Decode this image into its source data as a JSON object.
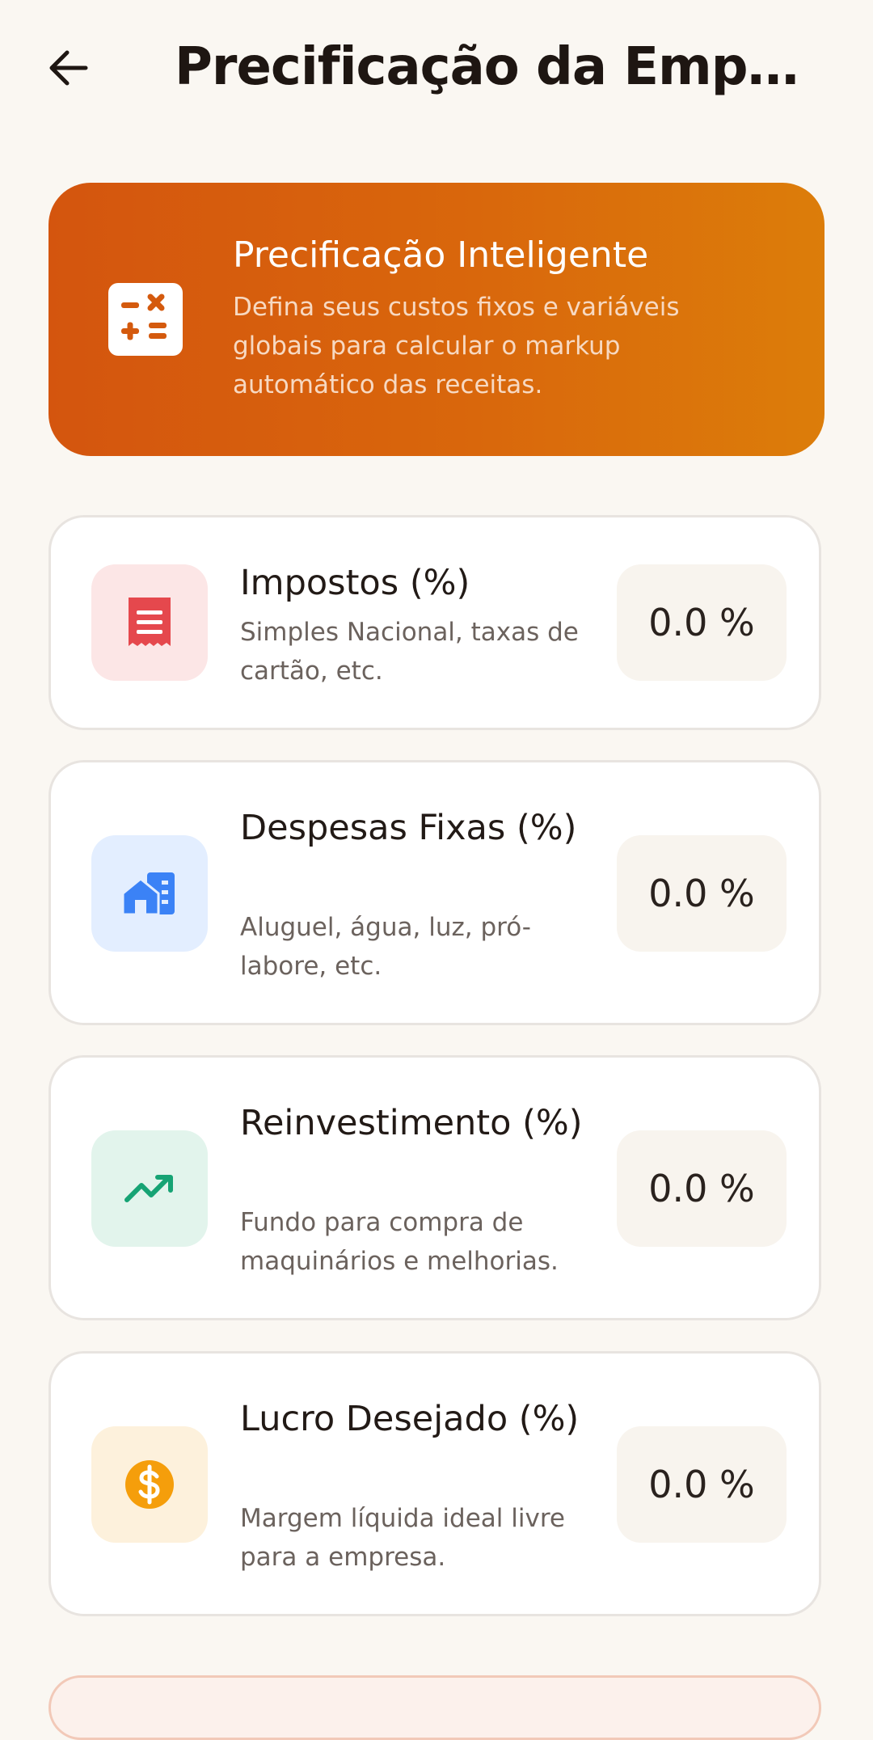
{
  "header": {
    "title": "Precificação da Empr…",
    "back_icon": "arrow-left-icon"
  },
  "hero": {
    "title": "Precificação Inteligente",
    "description": "Defina seus custos fixos e variáveis globais para calcular o markup automático das receitas.",
    "icon": "calculator-icon",
    "gradient": [
      "#D4550E",
      "#DC7D0A"
    ]
  },
  "cards": [
    {
      "title": "Impostos (%)",
      "description": "Simples Nacional, taxas de cartão, etc.",
      "value": "0.0 %",
      "icon": "receipt-icon",
      "icon_color": "#E5484D",
      "icon_bg": "#FCE6E6"
    },
    {
      "title": "Despesas Fixas (%)",
      "description": "Aluguel, água, luz, pró-labore, etc.",
      "value": "0.0 %",
      "icon": "house-building-icon",
      "icon_color": "#3B82F6",
      "icon_bg": "#E3EEFF"
    },
    {
      "title": "Reinvestimento (%)",
      "description": "Fundo para compra de maquinários e melhorias.",
      "value": "0.0 %",
      "icon": "trending-up-icon",
      "icon_color": "#16A374",
      "icon_bg": "#E2F4EC"
    },
    {
      "title": "Lucro Desejado (%)",
      "description": "Margem líquida ideal livre para a empresa.",
      "value": "0.0 %",
      "icon": "dollar-coin-icon",
      "icon_color": "#F59E0B",
      "icon_bg": "#FDF1DC"
    }
  ]
}
